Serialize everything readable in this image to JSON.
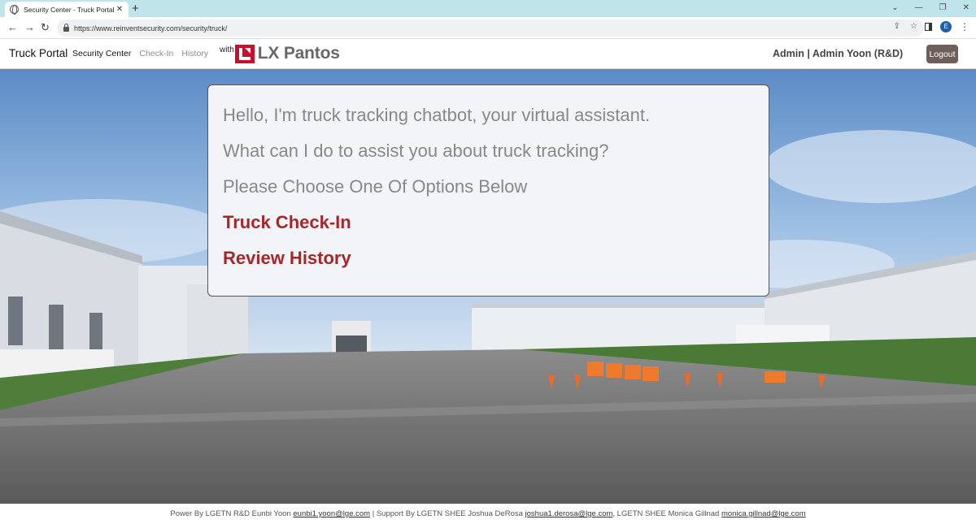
{
  "browser": {
    "tab_title": "Security Center - Truck Portal",
    "url": "https://www.reinventsecurity.com/security/truck/",
    "profile_initial": "E"
  },
  "navbar": {
    "brand": "Truck Portal",
    "links": [
      "Security Center",
      "Check-In",
      "History"
    ],
    "logo_with": "with",
    "logo_text": "LX Pantos",
    "user": "Admin | Admin Yoon (R&D)",
    "logout_label": "Logout"
  },
  "chat": {
    "greeting": "Hello, I'm truck tracking chatbot, your virtual assistant.",
    "question": "What can I do to assist you about truck tracking?",
    "prompt": "Please Choose One Of Options Below",
    "options": [
      "Truck Check-In",
      "Review History"
    ]
  },
  "footer": {
    "power_prefix": "Power By LGETN R&D Eunbi Yoon",
    "power_email": "eunbi1.yoon@lge.com",
    "support_prefix": "| Support By LGETN SHEE Joshua DeRosa",
    "support_email1": "joshua1.derosa@lge.com",
    "support_mid": ", LGETN SHEE Monica Gillnad",
    "support_email2": "monica.gillnad@lge.com"
  },
  "colors": {
    "accent": "#a3282a",
    "logout_bg": "#6e5f5b",
    "tabstrip": "#bfe4ea"
  }
}
